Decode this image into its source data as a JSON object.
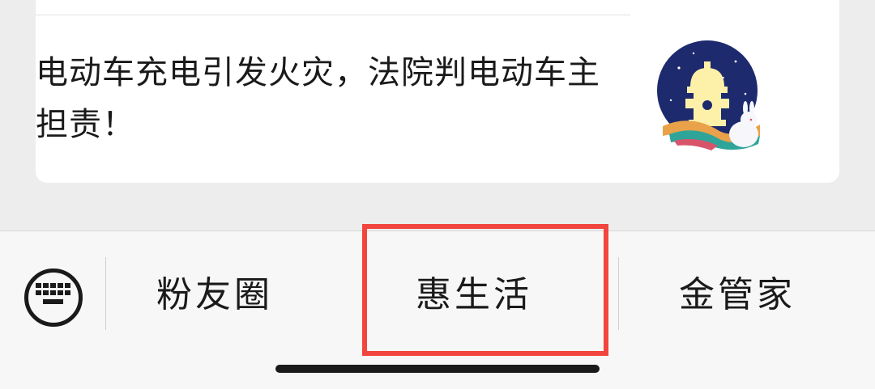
{
  "article": {
    "title": "电动车充电引发火灾，法院判电动车主担责！",
    "thumbnail_icon": "fire-hydrant-moon-icon"
  },
  "bottom_menu": {
    "keyboard_icon": "keyboard-icon",
    "items": [
      {
        "label": "粉友圈"
      },
      {
        "label": "惠生活"
      },
      {
        "label": "金管家"
      }
    ],
    "highlighted_index": 1
  },
  "colors": {
    "highlight": "#f1453d",
    "background": "#ededed",
    "menu_bar": "#f7f7f7"
  }
}
